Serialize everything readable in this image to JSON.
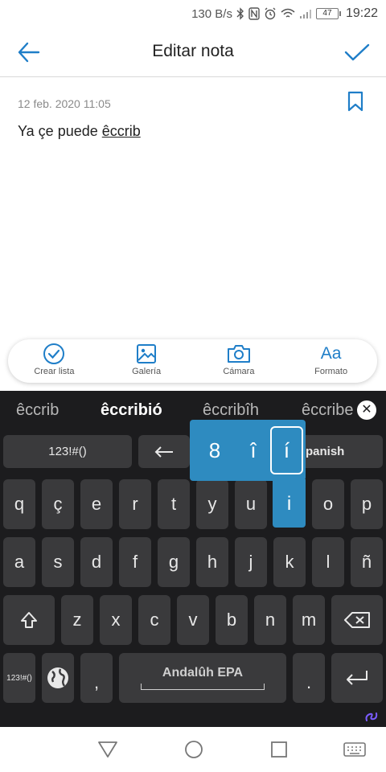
{
  "status_bar": {
    "network_speed": "130 B/s",
    "battery": "47",
    "time": "19:22"
  },
  "header": {
    "title": "Editar nota"
  },
  "note": {
    "date": "12 feb. 2020 11:05",
    "text_plain": "Ya çe puede ",
    "text_underlined": "êccrib"
  },
  "toolbar": {
    "items": [
      {
        "label": "Crear lista"
      },
      {
        "label": "Galería"
      },
      {
        "label": "Cámara"
      },
      {
        "label": "Formato",
        "icon_text": "Aa"
      }
    ]
  },
  "keyboard": {
    "suggestions": [
      "êccrib",
      "êccribió",
      "êccribîh",
      "êccribe"
    ],
    "row0": {
      "sym": "123!#()",
      "arrow": "←",
      "lang": "panish"
    },
    "row1": [
      "q",
      "ç",
      "e",
      "r",
      "t",
      "y",
      "u",
      "i",
      "o",
      "p"
    ],
    "row2": [
      "a",
      "s",
      "d",
      "f",
      "g",
      "h",
      "j",
      "k",
      "l",
      "ñ"
    ],
    "row3": [
      "z",
      "x",
      "c",
      "v",
      "b",
      "n",
      "m"
    ],
    "row4": {
      "sym": "123!#()",
      "comma": ",",
      "space": "Andalûh EPA",
      "period": "."
    },
    "popup": [
      "8",
      "î",
      "í"
    ],
    "popup_tail": "i"
  },
  "colors": {
    "accent": "#1f7ec8",
    "popup": "#2e8bc0",
    "keyboard_bg": "#1c1c1e",
    "key_bg": "#3a3a3c"
  }
}
